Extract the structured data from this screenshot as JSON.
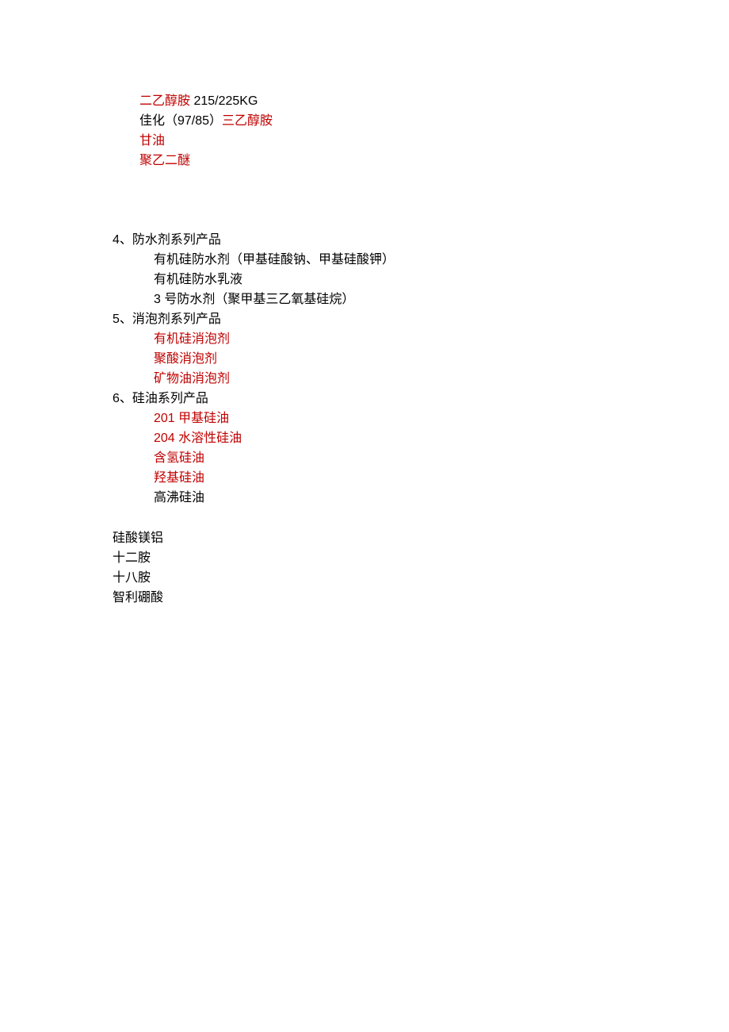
{
  "top": {
    "line1_red": "二乙醇胺 ",
    "line1_black": "215/225KG",
    "line2_black": "佳化（97/85）",
    "line2_red": "三乙醇胺",
    "line3": "甘油",
    "line4": "聚乙二醚"
  },
  "section4": {
    "header": "4、防水剂系列产品",
    "items": [
      "有机硅防水剂（甲基硅酸钠、甲基硅酸钾）",
      "有机硅防水乳液",
      "3 号防水剂（聚甲基三乙氧基硅烷）"
    ]
  },
  "section5": {
    "header": "5、消泡剂系列产品",
    "items": [
      "有机硅消泡剂",
      "聚酸消泡剂",
      "矿物油消泡剂"
    ]
  },
  "section6": {
    "header": "6、硅油系列产品",
    "items_red": [
      "201 甲基硅油",
      "204 水溶性硅油",
      "含氢硅油",
      "羟基硅油"
    ],
    "item_black": "高沸硅油"
  },
  "bottom": {
    "items": [
      "硅酸镁铝",
      "十二胺",
      "十八胺",
      "智利硼酸"
    ]
  }
}
